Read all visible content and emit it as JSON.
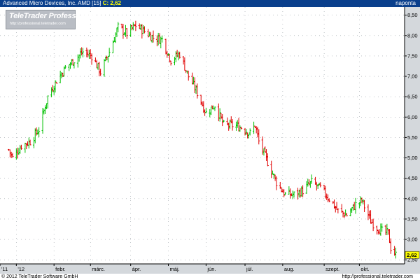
{
  "header": {
    "symbol_text": "Advanced Micro Devices, Inc. AMD [15]",
    "close_label": "C: 2,62",
    "period_label": "naponta"
  },
  "logo": {
    "name": "TeleTrader Professional",
    "url": "http://professional.teletrader.com"
  },
  "footer": {
    "copyright": "© 2012 TeleTrader Software GmbH",
    "url": "http://professional.teletrader.com"
  },
  "colors": {
    "header_bg": "#0a3f8c",
    "up": "#00c000",
    "down": "#e00000",
    "last_price_bg": "#ffff00",
    "axis_bg": "#d4d8dc"
  },
  "chart_data": {
    "type": "ohlc",
    "title": "Advanced Micro Devices, Inc. AMD [15]",
    "last_price": "2,62",
    "ylim": [
      2.4,
      8.7
    ],
    "y_ticks": [
      "2,50",
      "3,00",
      "3,50",
      "4,00",
      "4,50",
      "5,00",
      "5,50",
      "6,00",
      "6,50",
      "7,00",
      "7,50",
      "8,00",
      "8,50"
    ],
    "x_ticks": [
      "'11",
      "'12",
      "febr.",
      "márc.",
      "ápr.",
      "máj.",
      "jún.",
      "júl.",
      "aug.",
      "szept.",
      "okt."
    ],
    "grid": "dotted",
    "points": [
      {
        "date": "2011-12-27",
        "close": 5.2
      },
      {
        "date": "2011-12-30",
        "close": 5.0
      },
      {
        "date": "2012-01-06",
        "close": 5.3
      },
      {
        "date": "2012-01-13",
        "close": 5.4
      },
      {
        "date": "2012-01-20",
        "close": 5.7
      },
      {
        "date": "2012-01-27",
        "close": 6.5
      },
      {
        "date": "2012-02-03",
        "close": 6.9
      },
      {
        "date": "2012-02-10",
        "close": 7.2
      },
      {
        "date": "2012-02-17",
        "close": 7.4
      },
      {
        "date": "2012-02-24",
        "close": 7.6
      },
      {
        "date": "2012-03-02",
        "close": 7.5
      },
      {
        "date": "2012-03-09",
        "close": 7.1
      },
      {
        "date": "2012-03-16",
        "close": 7.6
      },
      {
        "date": "2012-03-23",
        "close": 8.2
      },
      {
        "date": "2012-03-30",
        "close": 8.05
      },
      {
        "date": "2012-04-06",
        "close": 8.25
      },
      {
        "date": "2012-04-13",
        "close": 8.1
      },
      {
        "date": "2012-04-20",
        "close": 7.95
      },
      {
        "date": "2012-04-27",
        "close": 7.9
      },
      {
        "date": "2012-05-04",
        "close": 7.4
      },
      {
        "date": "2012-05-11",
        "close": 7.55
      },
      {
        "date": "2012-05-18",
        "close": 7.0
      },
      {
        "date": "2012-05-25",
        "close": 6.6
      },
      {
        "date": "2012-06-01",
        "close": 6.1
      },
      {
        "date": "2012-06-08",
        "close": 6.3
      },
      {
        "date": "2012-06-15",
        "close": 5.8
      },
      {
        "date": "2012-06-22",
        "close": 5.8
      },
      {
        "date": "2012-06-29",
        "close": 5.75
      },
      {
        "date": "2012-07-06",
        "close": 5.6
      },
      {
        "date": "2012-07-10",
        "close": 5.8
      },
      {
        "date": "2012-07-13",
        "close": 5.4
      },
      {
        "date": "2012-07-20",
        "close": 4.9
      },
      {
        "date": "2012-07-27",
        "close": 4.4
      },
      {
        "date": "2012-08-03",
        "close": 4.1
      },
      {
        "date": "2012-08-10",
        "close": 4.1
      },
      {
        "date": "2012-08-17",
        "close": 4.2
      },
      {
        "date": "2012-08-24",
        "close": 4.4
      },
      {
        "date": "2012-08-31",
        "close": 4.25
      },
      {
        "date": "2012-09-07",
        "close": 4.0
      },
      {
        "date": "2012-09-14",
        "close": 3.7
      },
      {
        "date": "2012-09-21",
        "close": 3.6
      },
      {
        "date": "2012-09-28",
        "close": 3.85
      },
      {
        "date": "2012-10-03",
        "close": 3.95
      },
      {
        "date": "2012-10-10",
        "close": 3.45
      },
      {
        "date": "2012-10-15",
        "close": 3.3
      },
      {
        "date": "2012-10-19",
        "close": 3.2
      },
      {
        "date": "2012-10-24",
        "close": 3.15
      },
      {
        "date": "2012-10-26",
        "close": 2.8
      },
      {
        "date": "2012-10-30",
        "close": 2.62
      }
    ]
  }
}
